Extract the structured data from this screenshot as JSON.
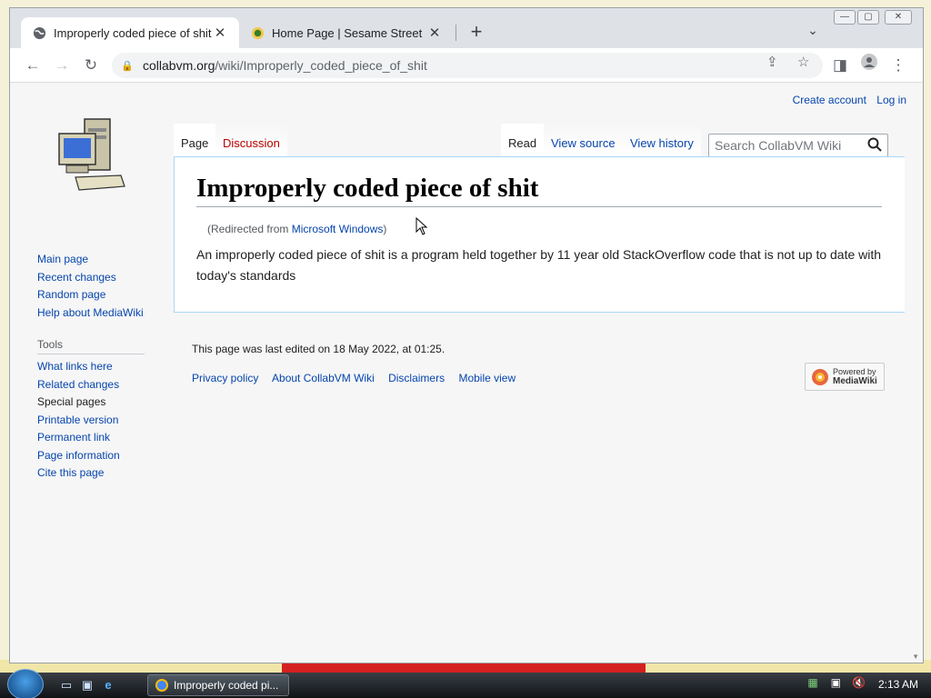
{
  "browser": {
    "tabs": [
      {
        "title": "Improperly coded piece of shit -",
        "active": true
      },
      {
        "title": "Home Page | Sesame Street | PBS",
        "active": false
      }
    ],
    "new_tab": "+",
    "tab_menu": "⌄",
    "address": {
      "host": "collabvm.org",
      "path": "/wiki/Improperly_coded_piece_of_shit"
    }
  },
  "wiki": {
    "personal": {
      "create_account": "Create account",
      "log_in": "Log in"
    },
    "tabs": {
      "page": "Page",
      "discussion": "Discussion",
      "read": "Read",
      "view_source": "View source",
      "view_history": "View history"
    },
    "search_placeholder": "Search CollabVM Wiki",
    "nav": [
      "Main page",
      "Recent changes",
      "Random page",
      "Help about MediaWiki"
    ],
    "tools_heading": "Tools",
    "tools": [
      "What links here",
      "Related changes",
      "Special pages",
      "Printable version",
      "Permanent link",
      "Page information",
      "Cite this page"
    ],
    "title": "Improperly coded piece of shit",
    "redirect_prefix": "(Redirected from ",
    "redirect_link": "Microsoft Windows",
    "redirect_suffix": ")",
    "body": "An improperly coded piece of shit is a program held together by 11 year old StackOverflow code that is not up to date with today's standards",
    "footer": {
      "last_edited": "This page was last edited on 18 May 2022, at 01:25.",
      "links": [
        "Privacy policy",
        "About CollabVM Wiki",
        "Disclaimers",
        "Mobile view"
      ]
    },
    "powered_by": {
      "line1": "Powered by",
      "line2": "MediaWiki"
    }
  },
  "taskbar": {
    "task_title": "Improperly coded pi...",
    "clock": "2:13 AM"
  }
}
